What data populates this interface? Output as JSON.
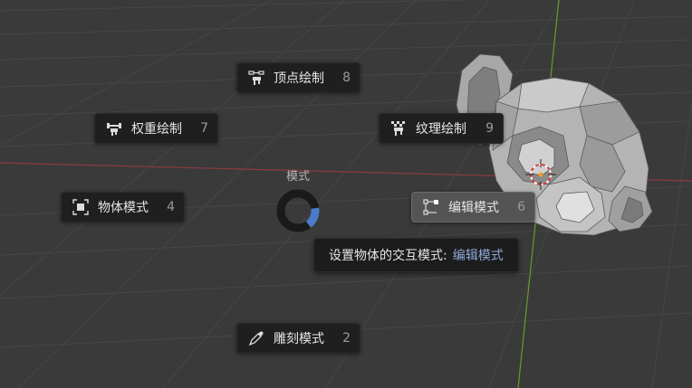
{
  "pie_menu": {
    "title": "模式",
    "items": [
      {
        "id": "vertex_paint",
        "label": "顶点绘制",
        "shortcut": "8",
        "icon": "vertex-paint-icon"
      },
      {
        "id": "weight_paint",
        "label": "权重绘制",
        "shortcut": "7",
        "icon": "weight-paint-icon"
      },
      {
        "id": "texture_paint",
        "label": "纹理绘制",
        "shortcut": "9",
        "icon": "texture-paint-icon"
      },
      {
        "id": "object_mode",
        "label": "物体模式",
        "shortcut": "4",
        "icon": "object-mode-icon"
      },
      {
        "id": "edit_mode",
        "label": "编辑模式",
        "shortcut": "6",
        "icon": "edit-mode-icon",
        "active": true
      },
      {
        "id": "sculpt_mode",
        "label": "雕刻模式",
        "shortcut": "2",
        "icon": "sculpt-mode-icon"
      }
    ]
  },
  "tooltip": {
    "prefix": "设置物体的交互模式:",
    "value": "编辑模式"
  },
  "colors": {
    "viewport_bg": "#3a3a3a",
    "grid_line": "#454545",
    "x_axis": "#8c3a40",
    "y_axis": "#6a9a2c",
    "button_bg": "#1f1f1f",
    "button_active_bg": "#545454",
    "accent_blue": "#4a7cc9",
    "tooltip_value": "#8fa8d8"
  }
}
